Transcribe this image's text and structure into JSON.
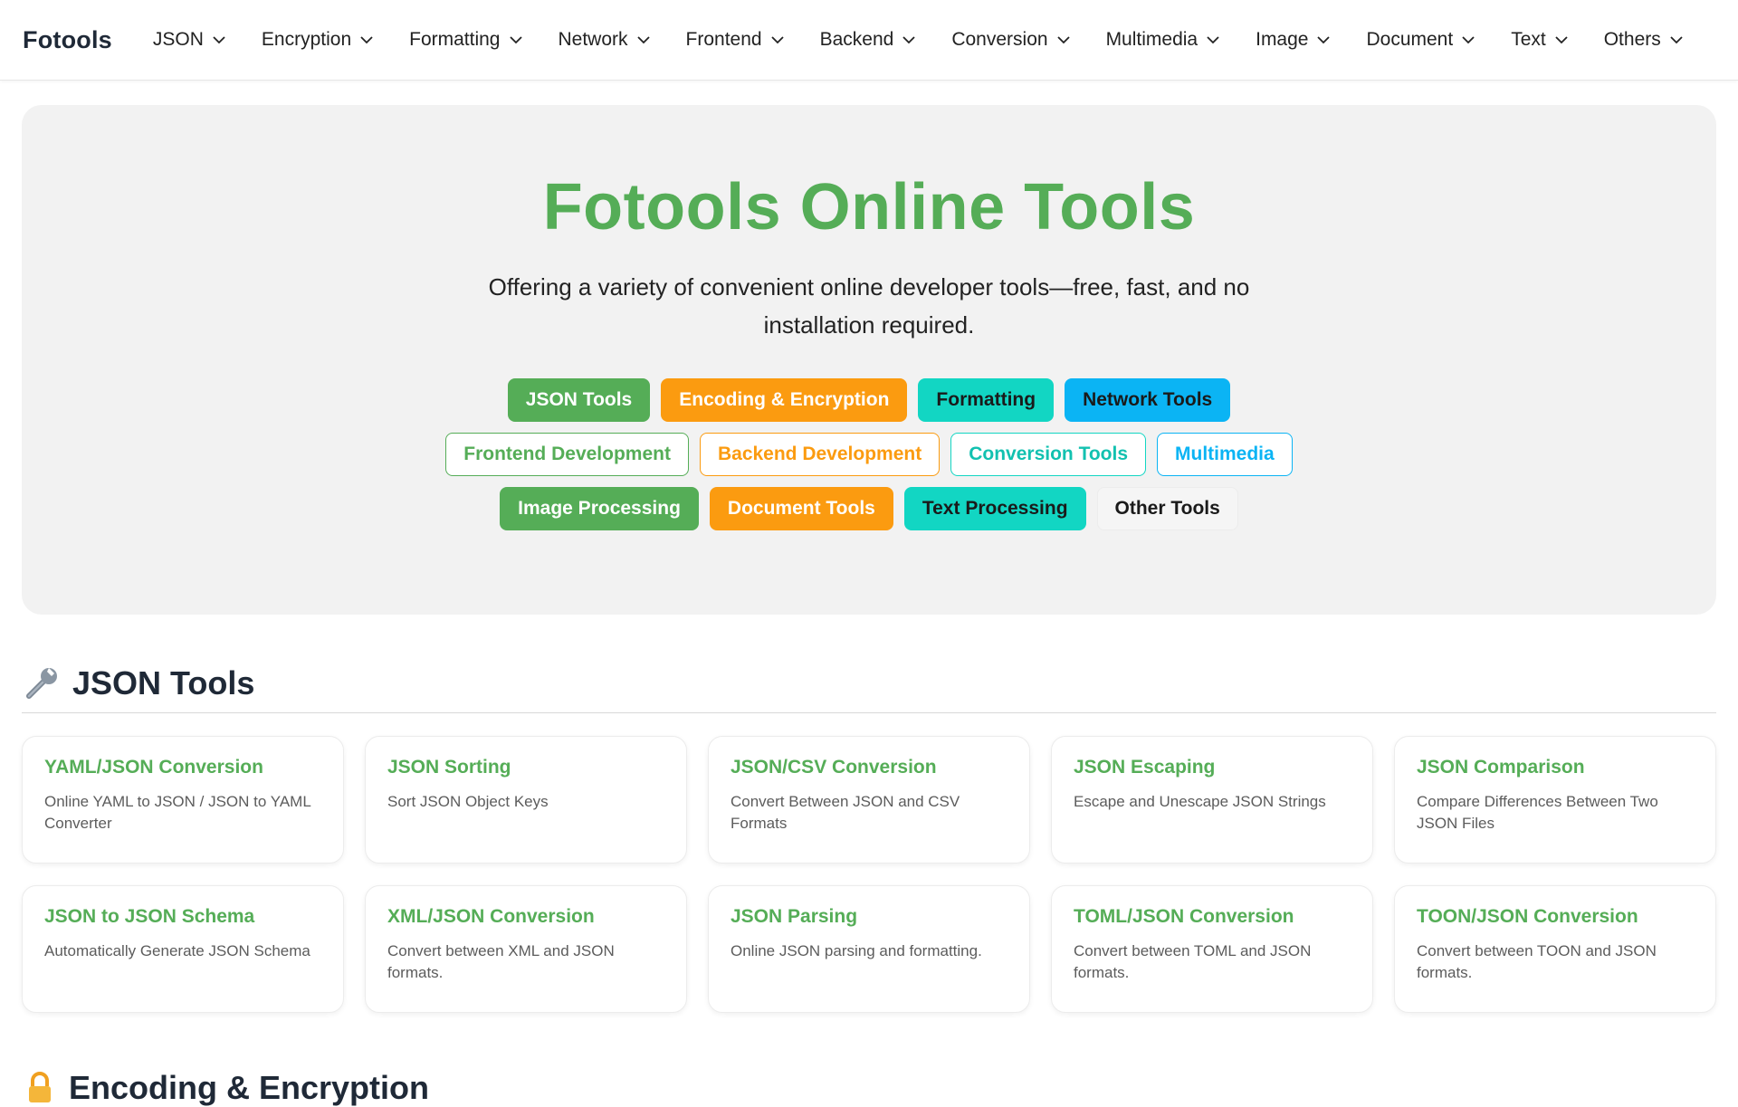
{
  "brand": "Fotools",
  "nav": [
    {
      "label": "JSON"
    },
    {
      "label": "Encryption"
    },
    {
      "label": "Formatting"
    },
    {
      "label": "Network"
    },
    {
      "label": "Frontend"
    },
    {
      "label": "Backend"
    },
    {
      "label": "Conversion"
    },
    {
      "label": "Multimedia"
    },
    {
      "label": "Image"
    },
    {
      "label": "Document"
    },
    {
      "label": "Text"
    },
    {
      "label": "Others"
    }
  ],
  "hero": {
    "title": "Fotools Online Tools",
    "subtitle": "Offering a variety of convenient online developer tools—free, fast, and no installation required.",
    "tags": [
      "JSON Tools",
      "Encoding & Encryption",
      "Formatting",
      "Network Tools",
      "Frontend Development",
      "Backend Development",
      "Conversion Tools",
      "Multimedia",
      "Image Processing",
      "Document Tools",
      "Text Processing",
      "Other Tools"
    ]
  },
  "section": {
    "title": "JSON Tools",
    "icon": "wrench-icon",
    "cards": [
      {
        "title": "YAML/JSON Conversion",
        "desc": "Online YAML to JSON / JSON to YAML Converter"
      },
      {
        "title": "JSON Sorting",
        "desc": "Sort JSON Object Keys"
      },
      {
        "title": "JSON/CSV Conversion",
        "desc": "Convert Between JSON and CSV Formats"
      },
      {
        "title": "JSON Escaping",
        "desc": "Escape and Unescape JSON Strings"
      },
      {
        "title": "JSON Comparison",
        "desc": "Compare Differences Between Two JSON Files"
      },
      {
        "title": "JSON to JSON Schema",
        "desc": "Automatically Generate JSON Schema"
      },
      {
        "title": "XML/JSON Conversion",
        "desc": "Convert between XML and JSON formats."
      },
      {
        "title": "JSON Parsing",
        "desc": "Online JSON parsing and formatting."
      },
      {
        "title": "TOML/JSON Conversion",
        "desc": "Convert between TOML and JSON formats."
      },
      {
        "title": "TOON/JSON Conversion",
        "desc": "Convert between TOON and JSON formats."
      }
    ]
  },
  "next_section": {
    "title": "Encoding & Encryption",
    "icon": "lock-icon"
  },
  "colors": {
    "green": "#55ad57",
    "orange": "#fb9b10",
    "teal": "#12d6c3",
    "blue": "#0bb4f4"
  }
}
